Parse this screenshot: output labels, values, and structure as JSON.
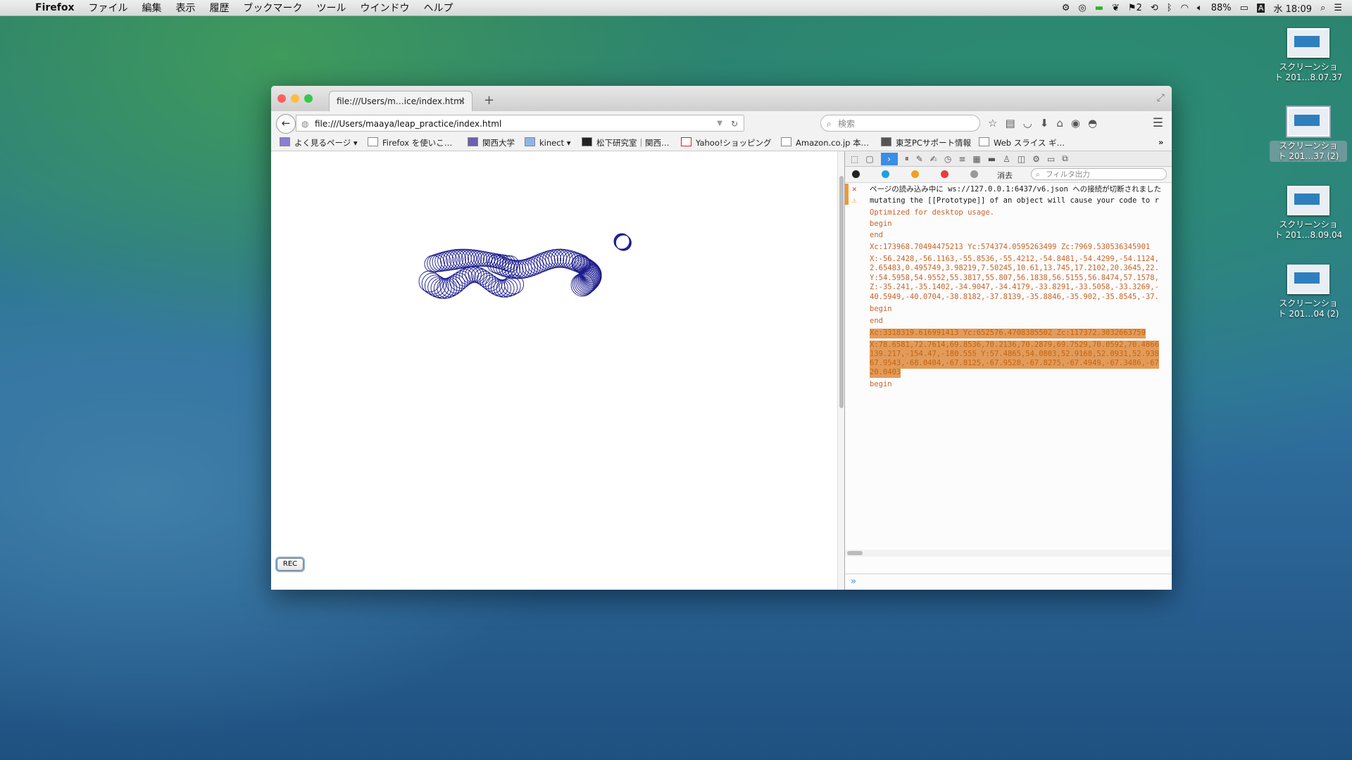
{
  "menubar": {
    "apple": "",
    "items": [
      "Firefox",
      "ファイル",
      "編集",
      "表示",
      "履歴",
      "ブックマーク",
      "ツール",
      "ウインドウ",
      "ヘルプ"
    ],
    "input_method": "2",
    "battery": "88%",
    "clock": "水 18:09",
    "ime_letter": "A"
  },
  "desktop": {
    "items": [
      {
        "line1": "スクリーンショ",
        "line2": "ト 201…8.07.37"
      },
      {
        "line1": "スクリーンショ",
        "line2": "ト 201…37 (2)"
      },
      {
        "line1": "スクリーンショ",
        "line2": "ト 201…8.09.04"
      },
      {
        "line1": "スクリーンショ",
        "line2": "ト 201…04 (2)"
      }
    ]
  },
  "browser": {
    "tab_title": "file:///Users/m…ice/index.html",
    "url": "file:///Users/maaya/leap_practice/index.html",
    "search_placeholder": "検索",
    "bookmarks": [
      "よく見るページ",
      "Firefox を使いこ…",
      "関西大学",
      "kinect",
      "松下研究室｜関西…",
      "Yahoo!ショッピング",
      "Amazon.co.jp 本…",
      "東芝PCサポート情報",
      "Web スライス ギ…"
    ],
    "rec_button": "REC"
  },
  "devtools": {
    "filter_placeholder": "フィルタ出力",
    "clear_label": "消去",
    "log": [
      {
        "icon": "error",
        "text": "ページの読み込み中に ws://127.0.0.1:6437/v6.json への接続が切断されました"
      },
      {
        "icon": "warn",
        "text": "mutating the [[Prototype]] of an object will cause your code to r"
      },
      {
        "text": "Optimized for desktop usage."
      },
      {
        "text": "begin"
      },
      {
        "text": "end"
      },
      {
        "text": "Xc:173968.70494475213 Yc:574374.0595263499 Zc:7969.530536345901"
      },
      {
        "text": "X:-56.2428,-56.1163,-55.8536,-55.4212,-54.8481,-54.4299,-54.1124,"
      },
      {
        "text": "2.65483,0.495749,3.98219,7.50245,10.61,13.745,17.2102,20.3645,22."
      },
      {
        "text": "Y:54.5958,54.9552,55.3817,55.807,56.1838,56.5155,56.8474,57.1578,"
      },
      {
        "text": "Z:-35.241,-35.1402,-34.9047,-34.4179,-33.8291,-33.5058,-33.3269,-"
      },
      {
        "text": "40.5949,-40.0704,-38.8182,-37.8139,-35.8846,-35.902,-35.8545,-37."
      },
      {
        "text": "begin"
      },
      {
        "text": "end"
      },
      {
        "text": "Xc:3318319.616991413 Yc:652576.4708385502 Zc:117372.3032663759"
      },
      {
        "text": "X:78.6581,72.7614,69.8536,70.2136,70.2879,69.7529,70.0592,70.4866"
      },
      {
        "text": "139.217,-154.47,-180.555 Y:57.4865,54.0803,52.9168,52.0931,52.938"
      },
      {
        "text": "67.9543,-68.0404,-67.8125,-67.9528,-67.8275,-67.4949,-67.3486,-67"
      },
      {
        "text": "20.0403"
      },
      {
        "text": "begin"
      }
    ]
  },
  "colors": {
    "circle_stroke": "#1a1a8c",
    "log_orange": "#c8642a",
    "selection": "#e39b5a"
  }
}
